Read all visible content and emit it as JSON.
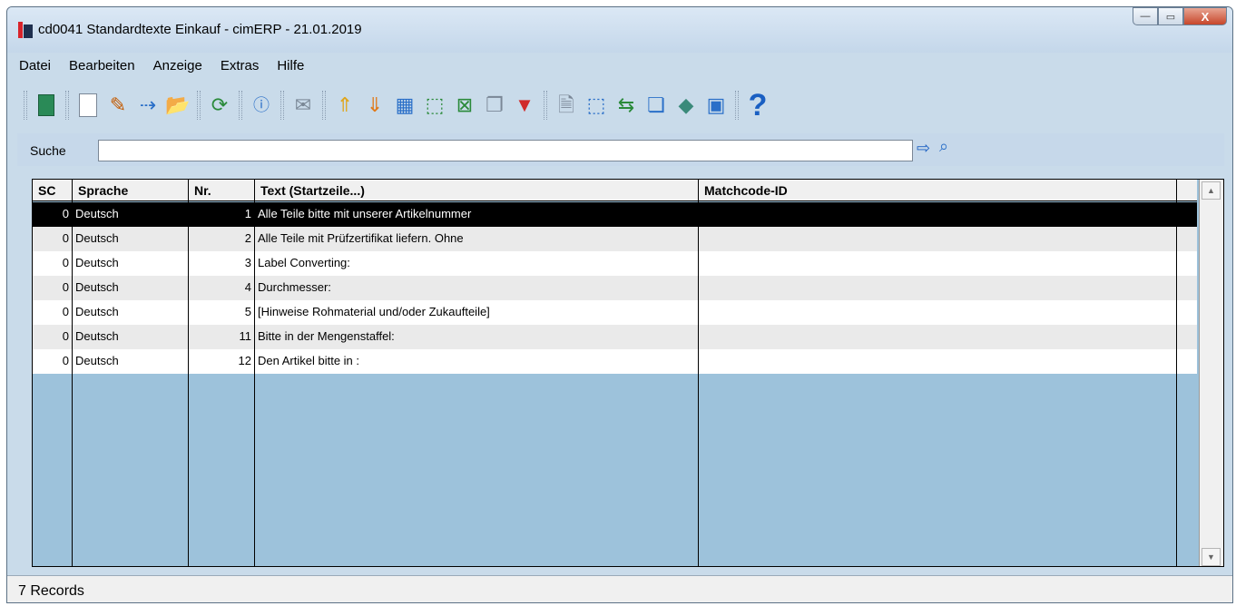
{
  "window": {
    "title": "cd0041 Standardtexte Einkauf - cimERP - 21.01.2019",
    "minimize": "—",
    "maximize": "▭",
    "close": "X"
  },
  "menu": {
    "items": [
      {
        "label": "Datei"
      },
      {
        "label": "Bearbeiten"
      },
      {
        "label": "Anzeige"
      },
      {
        "label": "Extras"
      },
      {
        "label": "Hilfe"
      }
    ]
  },
  "toolbar": {
    "icons": [
      "exit-door-icon",
      "new-document-icon",
      "edit-document-icon",
      "copy-icon",
      "open-folder-icon",
      "refresh-icon",
      "info-icon",
      "mail-icon",
      "sort-ascending-icon",
      "sort-descending-icon",
      "calculator-icon",
      "export-icon",
      "excel-export-icon",
      "duplicate-icon",
      "filter-icon",
      "properties-icon",
      "select-area-icon",
      "transfer-icon",
      "windows-icon",
      "tag-icon",
      "grid-view-icon",
      "help-icon"
    ]
  },
  "search": {
    "label": "Suche",
    "value": "",
    "placeholder": ""
  },
  "table": {
    "columns": [
      "SC",
      "Sprache",
      "Nr.",
      "Text (Startzeile...)",
      "Matchcode-ID"
    ],
    "rows": [
      {
        "sc": "0",
        "sprache": "Deutsch",
        "nr": "1",
        "text": "Alle Teile bitte mit unserer Artikelnummer",
        "matchcode": ""
      },
      {
        "sc": "0",
        "sprache": "Deutsch",
        "nr": "2",
        "text": "Alle Teile mit Prüfzertifikat liefern. Ohne",
        "matchcode": ""
      },
      {
        "sc": "0",
        "sprache": "Deutsch",
        "nr": "3",
        "text": "Label Converting:",
        "matchcode": ""
      },
      {
        "sc": "0",
        "sprache": "Deutsch",
        "nr": "4",
        "text": "Durchmesser:",
        "matchcode": ""
      },
      {
        "sc": "0",
        "sprache": "Deutsch",
        "nr": "5",
        "text": "[Hinweise Rohmaterial und/oder Zukaufteile]",
        "matchcode": ""
      },
      {
        "sc": "0",
        "sprache": "Deutsch",
        "nr": "11",
        "text": "Bitte in der Mengenstaffel:",
        "matchcode": ""
      },
      {
        "sc": "0",
        "sprache": "Deutsch",
        "nr": "12",
        "text": "Den Artikel bitte in :",
        "matchcode": ""
      }
    ]
  },
  "status": {
    "text": "7 Records"
  },
  "colors": {
    "selected_row": "#000000",
    "grid_background": "#9dc2db",
    "window_background": "#c9dbea"
  }
}
